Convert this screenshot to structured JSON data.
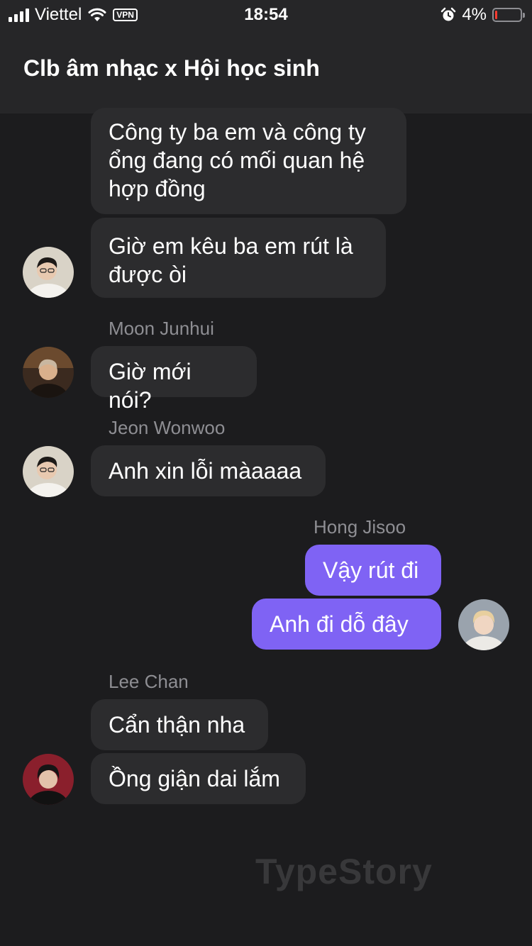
{
  "status_bar": {
    "carrier": "Viettel",
    "vpn": "VPN",
    "time": "18:54",
    "battery": "4%",
    "battery_level": 0.04
  },
  "header": {
    "title": "Clb âm nhạc x Hội học sinh"
  },
  "messages": [
    {
      "text": "Công ty ba em và công ty\nổng đang có mối quan hệ\nhợp đồng",
      "sender": "",
      "outgoing": false
    },
    {
      "text": "Giờ em kêu ba em rút là\nđược òi",
      "sender": "",
      "outgoing": false
    },
    {
      "text": "Giờ mới nói?",
      "sender": "Moon Junhui",
      "outgoing": false
    },
    {
      "text": "Anh xin lỗi màaaaa",
      "sender": "Jeon Wonwoo",
      "outgoing": false
    },
    {
      "text": "Vậy rút đi",
      "sender": "Hong Jisoo",
      "outgoing": true
    },
    {
      "text": "Anh đi dỗ đây",
      "sender": "Hong Jisoo",
      "outgoing": true
    },
    {
      "text": "Cẩn thận nha",
      "sender": "Lee Chan",
      "outgoing": false
    },
    {
      "text": "Ồng giận dai lắm",
      "sender": "Lee Chan",
      "outgoing": false
    }
  ],
  "senders": {
    "moon": "Moon Junhui",
    "jeon": "Jeon Wonwoo",
    "hong": "Hong Jisoo",
    "lee": "Lee Chan"
  },
  "watermark": "TypeStory",
  "colors": {
    "background": "#1c1c1e",
    "bubble_incoming": "#2c2c2e",
    "bubble_outgoing": "#7f63f4",
    "sender_name": "#8e8e93",
    "battery_low": "#ff3b30"
  }
}
